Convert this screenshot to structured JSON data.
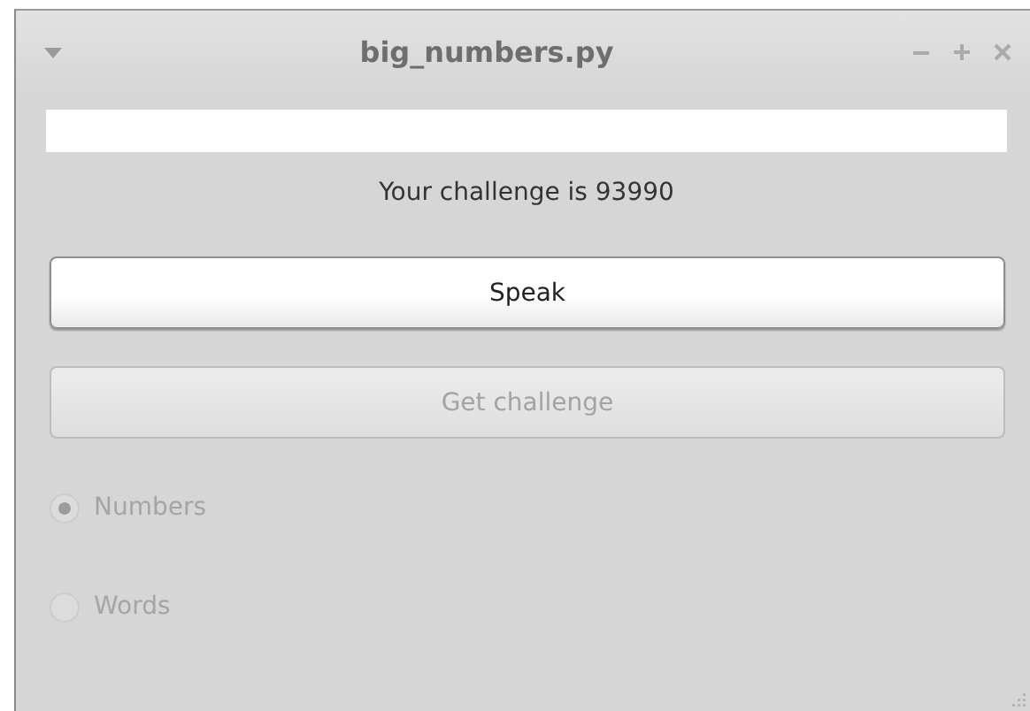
{
  "window": {
    "title": "big_numbers.py"
  },
  "challenge_label": "Your challenge is 93990",
  "buttons": [
    {
      "label": "Speak",
      "disabled": false
    },
    {
      "label": "Get challenge",
      "disabled": true
    }
  ],
  "radios": [
    {
      "label": "Numbers",
      "selected": true,
      "disabled": true
    },
    {
      "label": "Words",
      "selected": false,
      "disabled": true
    }
  ]
}
